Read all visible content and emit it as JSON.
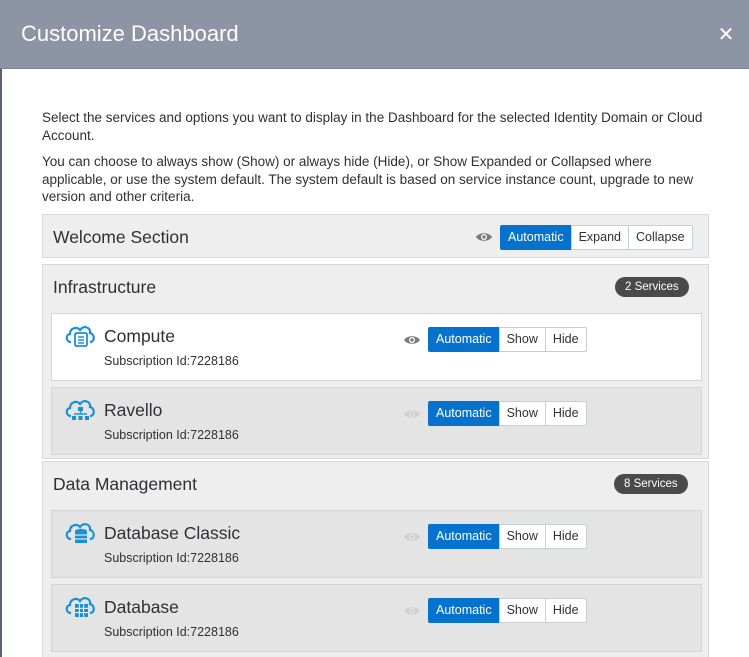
{
  "dialog": {
    "title": "Customize Dashboard",
    "close_icon": "close-icon",
    "close_glyph": "✕"
  },
  "description": {
    "line1": "Select the services and options you want to display in the Dashboard for the selected Identity Domain or Cloud Account.",
    "line2": "You can choose to always show (Show) or always hide (Hide), or Show Expanded or Collapsed where applicable, or use the system default. The system default is based on service instance count, upgrade to new version and other criteria."
  },
  "welcome": {
    "title": "Welcome Section",
    "icon": "eye-icon",
    "options": [
      "Automatic",
      "Expand",
      "Collapse"
    ],
    "selected": "Automatic"
  },
  "sections": [
    {
      "title": "Infrastructure",
      "badge": "2 Services",
      "services": [
        {
          "name": "Compute",
          "subscription": "Subscription Id:7228186",
          "icon": "cloud-compute-icon",
          "options": [
            "Automatic",
            "Show",
            "Hide"
          ],
          "selected": "Automatic"
        },
        {
          "name": "Ravello",
          "subscription": "Subscription Id:7228186",
          "icon": "cloud-network-icon",
          "options": [
            "Automatic",
            "Show",
            "Hide"
          ],
          "selected": "Automatic"
        }
      ]
    },
    {
      "title": "Data Management",
      "badge": "8 Services",
      "services": [
        {
          "name": "Database Classic",
          "subscription": "Subscription Id:7228186",
          "icon": "cloud-database-icon",
          "options": [
            "Automatic",
            "Show",
            "Hide"
          ],
          "selected": "Automatic"
        },
        {
          "name": "Database",
          "subscription": "Subscription Id:7228186",
          "icon": "cloud-database-grid-icon",
          "options": [
            "Automatic",
            "Show",
            "Hide"
          ],
          "selected": "Automatic"
        }
      ]
    }
  ],
  "colors": {
    "header": "#8d94a3",
    "accent": "#0572ce",
    "badge": "#4a4a4a",
    "icon": "#1a8fd6"
  }
}
